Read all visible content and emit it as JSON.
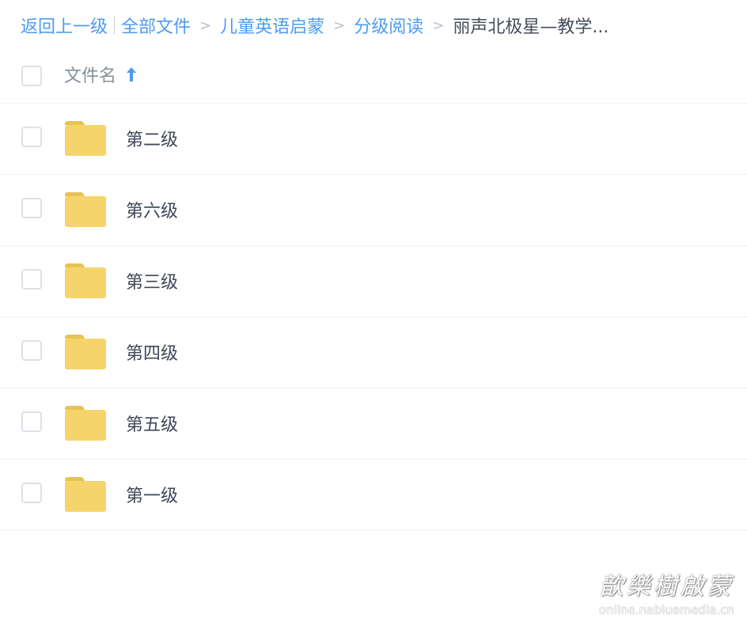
{
  "breadcrumb": {
    "back": "返回上一级",
    "items": [
      "全部文件",
      "儿童英语启蒙",
      "分级阅读"
    ],
    "separator": ">",
    "current": "丽声北极星—教学..."
  },
  "header": {
    "column_title": "文件名",
    "sort_icon": "arrow-up-icon"
  },
  "files": [
    {
      "name": "第二级",
      "icon": "folder-icon"
    },
    {
      "name": "第六级",
      "icon": "folder-icon"
    },
    {
      "name": "第三级",
      "icon": "folder-icon"
    },
    {
      "name": "第四级",
      "icon": "folder-icon"
    },
    {
      "name": "第五级",
      "icon": "folder-icon"
    },
    {
      "name": "第一级",
      "icon": "folder-icon"
    }
  ],
  "watermark": {
    "title": "歆樂樹啟蒙",
    "url": "online.nabluemedia.cn"
  },
  "colors": {
    "link": "#4e9bf0",
    "folder": "#f5d56b",
    "folder_tab": "#e7c254",
    "border": "#f1f2f4"
  }
}
